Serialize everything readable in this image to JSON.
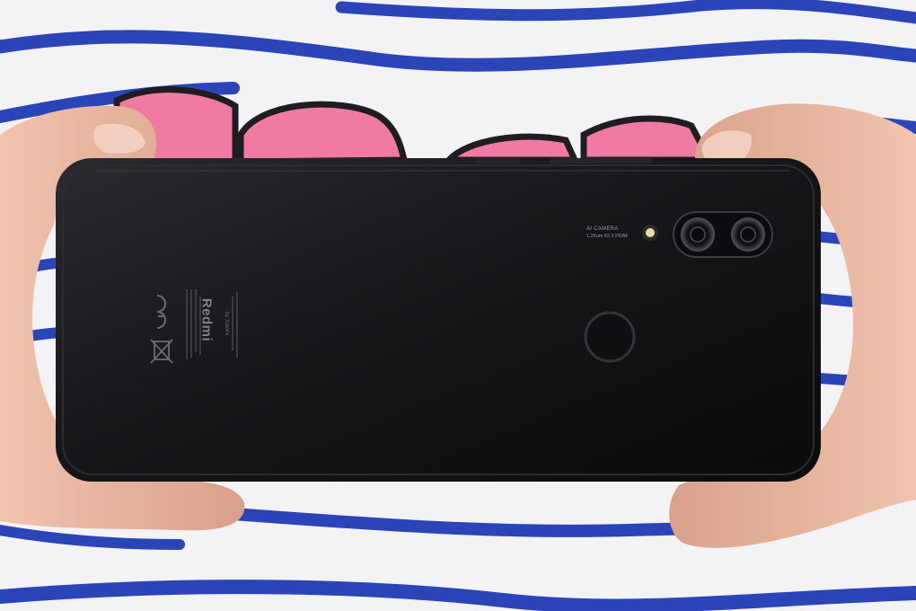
{
  "phone": {
    "brand": "Redmi",
    "brand_sub": "by Xiaomi",
    "camera_label_line1": "AI CAMERA",
    "camera_label_line2": "1.25um f/2.2 PDAF"
  },
  "colors": {
    "shirt_white": "#f3f3f5",
    "stripe_blue": "#2b45b8",
    "phone_black": "#17171b",
    "pink_pattern": "#f07aa2",
    "skin": "#e9b79e"
  }
}
